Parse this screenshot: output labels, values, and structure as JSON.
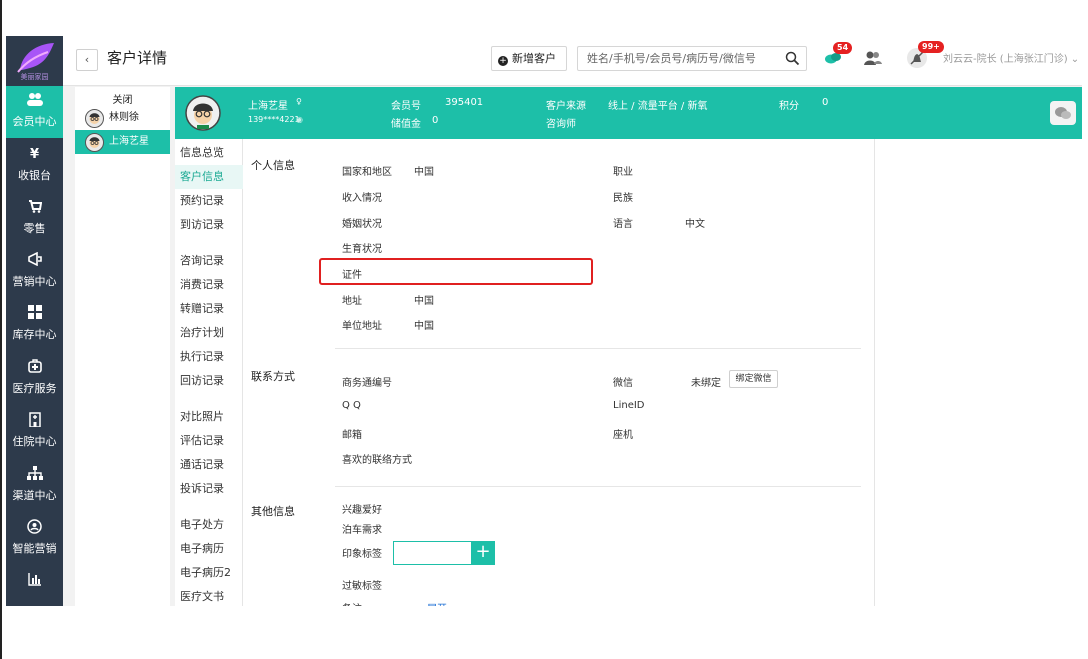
{
  "nav": {
    "logo_text": "美丽家园",
    "items": [
      {
        "label": "会员中心",
        "icon": "users-icon",
        "glyph": "👥"
      },
      {
        "label": "收银台",
        "icon": "yen-icon",
        "glyph": "¥"
      },
      {
        "label": "零售",
        "icon": "cart-icon",
        "glyph": "🛒"
      },
      {
        "label": "营销中心",
        "icon": "megaphone-icon",
        "glyph": "📢"
      },
      {
        "label": "库存中心",
        "icon": "grid-icon",
        "glyph": "▦"
      },
      {
        "label": "医疗服务",
        "icon": "medkit-icon",
        "glyph": "✚"
      },
      {
        "label": "住院中心",
        "icon": "building-icon",
        "glyph": "🏥"
      },
      {
        "label": "渠道中心",
        "icon": "sitemap-icon",
        "glyph": "⊥"
      },
      {
        "label": "智能营销",
        "icon": "target-icon",
        "glyph": "◎"
      },
      {
        "label": "",
        "icon": "bar-chart-icon",
        "glyph": "▥"
      }
    ]
  },
  "header": {
    "back": "‹",
    "title": "客户详情",
    "add_customer": "新增客户",
    "search_placeholder": "姓名/手机号/会员号/病历号/微信号",
    "chat_badge": "54",
    "notify_badge": "99+",
    "user": "刘云云-院长 (上海张江门诊) ⌄"
  },
  "customers": {
    "close": "关闭",
    "items": [
      "林则徐",
      "上海艺星"
    ]
  },
  "profile": {
    "name": "上海艺星",
    "phone": "139****4221",
    "member_no_label": "会员号",
    "member_no": "395401",
    "stored_value_label": "储值金",
    "stored_value": "0",
    "source_label": "客户来源",
    "source": "线上 / 流量平台 / 新氧",
    "consultant_label": "咨询师",
    "points_label": "积分",
    "points": "0"
  },
  "menu": [
    "信息总览",
    "客户信息",
    "预约记录",
    "到访记录",
    "咨询记录",
    "消费记录",
    "转赠记录",
    "治疗计划",
    "执行记录",
    "回访记录",
    "对比照片",
    "评估记录",
    "通话记录",
    "投诉记录",
    "电子处方",
    "电子病历",
    "电子病历2",
    "医疗文书"
  ],
  "personal": {
    "title": "个人信息",
    "country_label": "国家和地区",
    "country": "中国",
    "income_label": "收入情况",
    "marital_label": "婚姻状况",
    "fertility_label": "生育状况",
    "id_label": "证件",
    "address_label": "地址",
    "address": "中国",
    "work_address_label": "单位地址",
    "work_address": "中国",
    "job_label": "职业",
    "ethnicity_label": "民族",
    "language_label": "语言",
    "language": "中文"
  },
  "contact": {
    "title": "联系方式",
    "business_no_label": "商务通编号",
    "qq_label": "Q Q",
    "email_label": "邮箱",
    "preferred_label": "喜欢的联络方式",
    "wechat_label": "微信",
    "wechat": "未绑定",
    "bind_wechat": "绑定微信",
    "lineid_label": "LineID",
    "landline_label": "座机"
  },
  "other": {
    "title": "其他信息",
    "hobby_label": "兴趣爱好",
    "parking_label": "泊车需求",
    "impression_label": "印象标签",
    "allergy_label": "过敏标签",
    "remark_label": "备注",
    "expand": "展开"
  },
  "colors": {
    "accent": "#1dbfa8",
    "nav_bg": "#2d3a4b",
    "highlight": "#e02020",
    "badge": "#e52121"
  }
}
